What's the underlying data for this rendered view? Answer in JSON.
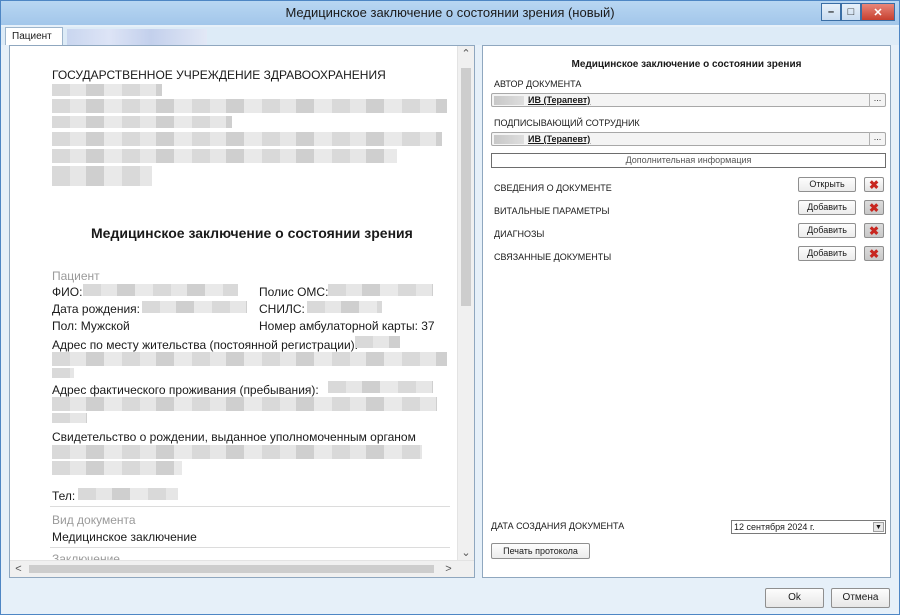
{
  "window": {
    "title": "Медицинское заключение о состоянии зрения (новый)",
    "minimize": "–",
    "maximize": "□",
    "close": "✕"
  },
  "tabs": {
    "active": "Пациент"
  },
  "document": {
    "org": "ГОСУДАРСТВЕННОЕ УЧРЕЖДЕНИЕ ЗДРАВООХРАНЕНИЯ",
    "heading": "Медицинское заключение о состоянии зрения",
    "patient_section": "Пациент",
    "fio_label": "ФИО:",
    "oms_label": "Полис ОМС:",
    "dob_label": "Дата рождения:",
    "snils_label": "СНИЛС:",
    "sex": "Пол: Мужской",
    "card": "Номер амбулаторной карты: 37",
    "reg_address": "Адрес по месту жительства (постоянной регистрации):",
    "fact_address": "Адрес фактического проживания (пребывания):",
    "certificate": "Свидетельство о рождении, выданное уполномоченным органом",
    "phone_label": "Тел:",
    "doc_type_label": "Вид документа",
    "doc_type_value": "Медицинское заключение",
    "conclusion_label": "Заключение"
  },
  "scroll": {
    "up": "⌃",
    "down": "⌄",
    "left": "<",
    "right": ">"
  },
  "side": {
    "title": "Медицинское заключение о состоянии зрения",
    "author_label": "АВТОР ДОКУМЕНТА",
    "author_value": "ИВ (Терапевт)",
    "signer_label": "ПОДПИСЫВАЮЩИЙ СОТРУДНИК",
    "signer_value": "ИВ (Терапевт)",
    "ellipsis": "...",
    "extra_info": "Дополнительная информация",
    "rows": [
      {
        "label": "СВЕДЕНИЯ О ДОКУМЕНТЕ",
        "button": "Открыть"
      },
      {
        "label": "ВИТАЛЬНЫЕ ПАРАМЕТРЫ",
        "button": "Добавить"
      },
      {
        "label": "ДИАГНОЗЫ",
        "button": "Добавить"
      },
      {
        "label": "СВЯЗАННЫЕ ДОКУМЕНТЫ",
        "button": "Добавить"
      }
    ],
    "delete_glyph": "✖",
    "date_label": "ДАТА СОЗДАНИЯ ДОКУМЕНТА",
    "date_value": "12 сентября 2024 г.",
    "dropdown_arrow": "▼",
    "print_button": "Печать протокола"
  },
  "footer": {
    "ok": "Ok",
    "cancel": "Отмена"
  }
}
